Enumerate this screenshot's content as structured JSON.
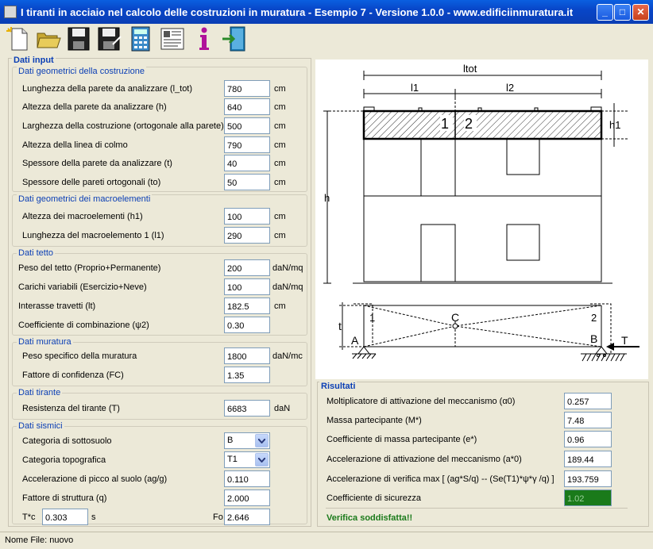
{
  "window": {
    "title": "I tiranti in acciaio nel calcolo delle costruzioni in muratura - Esempio 7 - Versione 1.0.0  - www.edificiinmuratura.it",
    "minimize": "_",
    "maximize": "□",
    "close": "✕"
  },
  "toolbar": {
    "icons": [
      "new-file-icon",
      "open-folder-icon",
      "save-icon",
      "save-as-icon",
      "calculator-icon",
      "report-icon",
      "info-icon",
      "exit-icon"
    ]
  },
  "input": {
    "title": "Dati input",
    "geo": {
      "title": "Dati geometrici della costruzione",
      "rows": [
        {
          "label": "Lunghezza della parete da analizzare (l_tot)",
          "value": "780",
          "unit": "cm"
        },
        {
          "label": "Altezza della parete da analizzare (h)",
          "value": "640",
          "unit": "cm"
        },
        {
          "label": "Larghezza della costruzione (ortogonale alla parete)",
          "value": "500",
          "unit": "cm"
        },
        {
          "label": "Altezza della linea di colmo",
          "value": "790",
          "unit": "cm"
        },
        {
          "label": "Spessore della parete da analizzare (t)",
          "value": "40",
          "unit": "cm"
        },
        {
          "label": "Spessore delle pareti ortogonali (to)",
          "value": "50",
          "unit": "cm"
        }
      ]
    },
    "macro": {
      "title": "Dati geometrici dei macroelementi",
      "rows": [
        {
          "label": "Altezza dei macroelementi (h1)",
          "value": "100",
          "unit": "cm"
        },
        {
          "label": "Lunghezza del macroelemento 1 (l1)",
          "value": "290",
          "unit": "cm"
        }
      ]
    },
    "tetto": {
      "title": "Dati tetto",
      "rows": [
        {
          "label": "Peso del tetto (Proprio+Permanente)",
          "value": "200",
          "unit": "daN/mq"
        },
        {
          "label": "Carichi variabili (Esercizio+Neve)",
          "value": "100",
          "unit": "daN/mq"
        },
        {
          "label": "Interasse travetti (lt)",
          "value": "182.5",
          "unit": "cm"
        },
        {
          "label": "Coefficiente di combinazione (ψ2)",
          "value": "0.30",
          "unit": ""
        }
      ]
    },
    "muratura": {
      "title": "Dati muratura",
      "rows": [
        {
          "label": "Peso specifico della muratura",
          "value": "1800",
          "unit": "daN/mc"
        },
        {
          "label": "Fattore di confidenza (FC)",
          "value": "1.35",
          "unit": ""
        }
      ]
    },
    "tirante": {
      "title": "Dati tirante",
      "rows": [
        {
          "label": "Resistenza del tirante (T)",
          "value": "6683",
          "unit": "daN"
        }
      ]
    },
    "sismici": {
      "title": "Dati sismici",
      "categoria_sottosuolo": {
        "label": "Categoria di sottosuolo",
        "value": "B"
      },
      "categoria_topografica": {
        "label": "Categoria topografica",
        "value": "T1"
      },
      "ag": {
        "label": "Accelerazione di picco al suolo (ag/g)",
        "value": "0.110"
      },
      "q": {
        "label": "Fattore di struttura (q)",
        "value": "2.000"
      },
      "tc": {
        "label": "T*c",
        "value": "0.303",
        "unit": "s"
      },
      "fo": {
        "label": "Fo",
        "value": "2.646"
      }
    }
  },
  "drawing": {
    "ltot": "ltot",
    "l1": "l1",
    "l2": "l2",
    "h1": "h1",
    "h": "h",
    "m1": "1",
    "m2": "2",
    "t": "t",
    "A": "A",
    "B": "B",
    "C": "C",
    "T": "T"
  },
  "results": {
    "title": "Risultati",
    "rows": [
      {
        "label": "Moltiplicatore di attivazione del meccanismo (α0)",
        "value": "0.257"
      },
      {
        "label": "Massa partecipante (M*)",
        "value": "7.48"
      },
      {
        "label": "Coefficiente di massa partecipante (e*)",
        "value": "0.96"
      },
      {
        "label": "Accelerazione di attivazione del meccanismo (a*0)",
        "value": "189.44"
      },
      {
        "label": "Accelerazione di verifica max [ (ag*S/q)  --  (Se(T1)*ψ*γ /q) ]",
        "value": "193.759"
      },
      {
        "label": "Coefficiente di sicurezza",
        "value": "1.02"
      }
    ],
    "verdict": "Verifica soddisfatta!!",
    "ok_color": "#1a7a1a"
  },
  "status": {
    "text": "Nome File: nuovo"
  }
}
